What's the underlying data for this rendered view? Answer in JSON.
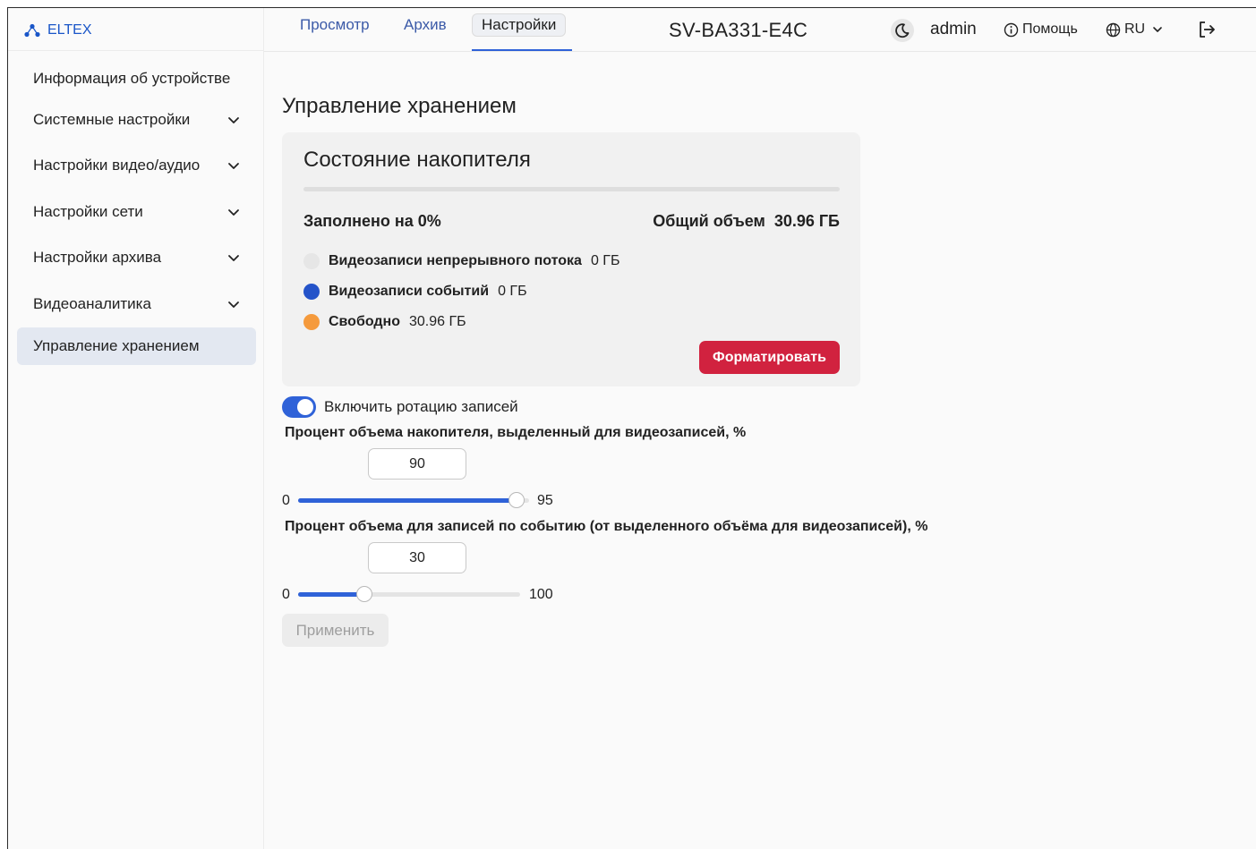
{
  "brand": {
    "name": "ELTEX",
    "color": "#1a56c8"
  },
  "sidebar": {
    "items": [
      {
        "label": "Информация об устройстве",
        "has_chevron": false,
        "active": false
      },
      {
        "label": "Системные настройки",
        "has_chevron": true,
        "active": false
      },
      {
        "label": "Настройки видео/аудио",
        "has_chevron": true,
        "active": false
      },
      {
        "label": "Настройки сети",
        "has_chevron": true,
        "active": false
      },
      {
        "label": "Настройки архива",
        "has_chevron": true,
        "active": false
      },
      {
        "label": "Видеоаналитика",
        "has_chevron": true,
        "active": false
      },
      {
        "label": "Управление хранением",
        "has_chevron": false,
        "active": true
      }
    ]
  },
  "topbar": {
    "tabs": [
      {
        "label": "Просмотр",
        "active": false
      },
      {
        "label": "Архив",
        "active": false
      },
      {
        "label": "Настройки",
        "active": true
      }
    ],
    "device_name": "SV-BA331-E4C",
    "user": "admin",
    "help_label": "Помощь",
    "language": "RU",
    "icons": [
      "theme-toggle-icon",
      "info-icon",
      "globe-icon",
      "logout-icon"
    ]
  },
  "main": {
    "title": "Управление хранением",
    "storage": {
      "title": "Состояние накопителя",
      "filled_label": "Заполнено на 0%",
      "filled_fraction": 0,
      "total_label": "Общий объем",
      "total_value": "30.96 ГБ",
      "legend": [
        {
          "label": "Видеозаписи непрерывного потока",
          "value": "0 ГБ",
          "color": "#e6e6e6"
        },
        {
          "label": "Видеозаписи событий",
          "value": "0 ГБ",
          "color": "#2453c9"
        },
        {
          "label": "Свободно",
          "value": "30.96 ГБ",
          "color": "#f59a3c"
        }
      ],
      "format_button": "Форматировать",
      "format_color": "#d1223f"
    },
    "rotation": {
      "label": "Включить ротацию записей",
      "enabled": true
    },
    "video_percent": {
      "label": "Процент объема накопителя, выделенный для видеозаписей, %",
      "value": "90",
      "min": "0",
      "max": "95",
      "slider_fraction": 0.947
    },
    "event_percent": {
      "label": "Процент объема для записей по событию (от выделенного объёма для видеозаписей), %",
      "value": "30",
      "min": "0",
      "max": "100",
      "slider_fraction": 0.3
    },
    "apply_button": "Применить",
    "accent_color": "#2f62d8"
  }
}
